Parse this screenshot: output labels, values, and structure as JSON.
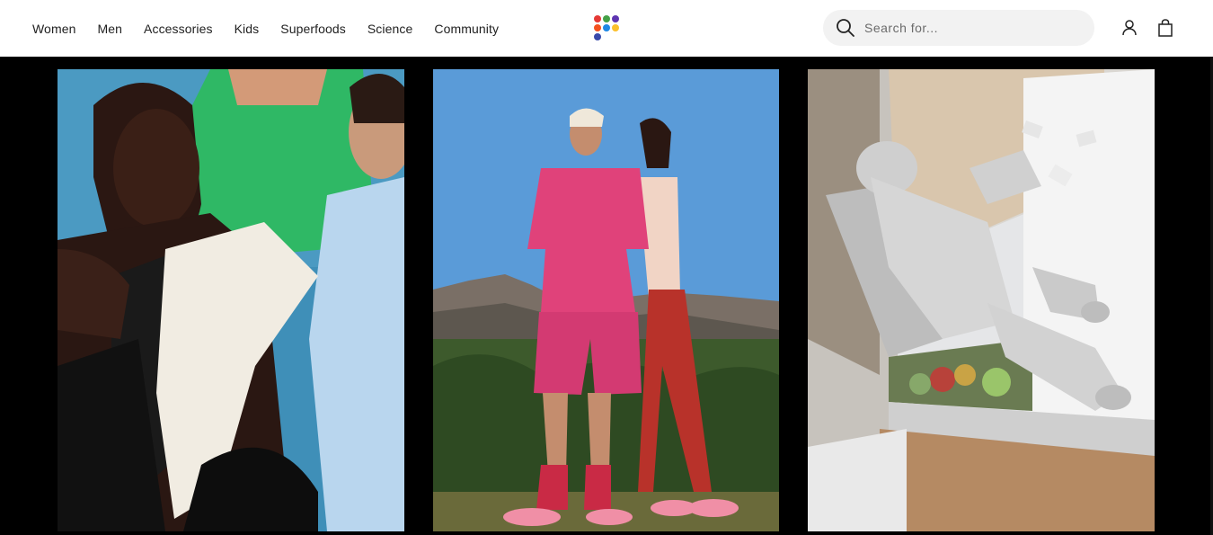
{
  "nav": {
    "items": [
      {
        "label": "Women"
      },
      {
        "label": "Men"
      },
      {
        "label": "Accessories"
      },
      {
        "label": "Kids"
      },
      {
        "label": "Superfoods"
      },
      {
        "label": "Science"
      },
      {
        "label": "Community"
      }
    ]
  },
  "logo": {
    "icon": "dot-grid-logo",
    "colors": [
      "#e53935",
      "#43a047",
      "#5e35b1",
      "#f4511e",
      "#1e88e5",
      "#fbc02d",
      "#3949ab"
    ]
  },
  "search": {
    "placeholder": "Search for...",
    "value": "",
    "icon": "search-icon"
  },
  "header_icons": [
    "account-icon",
    "cart-icon"
  ],
  "gallery": {
    "tiles": [
      {
        "subject": "group-in-hoodies-photo",
        "accent": "#2fb865"
      },
      {
        "subject": "pink-outfit-mountains-photo",
        "accent": "#e0427a"
      },
      {
        "subject": "astronaut-supermarket-photo",
        "accent": "#d8d8d8"
      }
    ]
  }
}
